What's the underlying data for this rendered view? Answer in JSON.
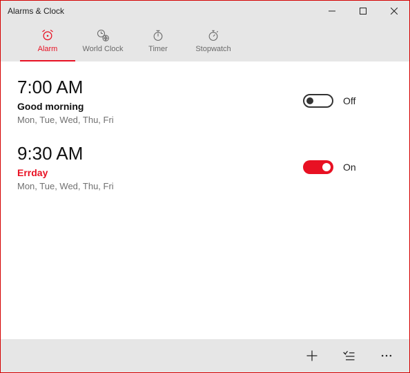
{
  "window": {
    "title": "Alarms & Clock"
  },
  "tabs": [
    {
      "label": "Alarm",
      "active": true,
      "icon": "alarm-icon"
    },
    {
      "label": "World Clock",
      "active": false,
      "icon": "world-clock-icon"
    },
    {
      "label": "Timer",
      "active": false,
      "icon": "timer-icon"
    },
    {
      "label": "Stopwatch",
      "active": false,
      "icon": "stopwatch-icon"
    }
  ],
  "alarms": [
    {
      "time": "7:00 AM",
      "name": "Good morning",
      "days": "Mon, Tue, Wed, Thu, Fri",
      "enabled": false,
      "toggle_label": "Off",
      "accent": false
    },
    {
      "time": "9:30 AM",
      "name": "Errday",
      "days": "Mon, Tue, Wed, Thu, Fri",
      "enabled": true,
      "toggle_label": "On",
      "accent": true
    }
  ],
  "bottombar": {
    "add": "add-icon",
    "select": "select-icon",
    "more": "more-icon"
  },
  "colors": {
    "accent": "#e81123"
  }
}
